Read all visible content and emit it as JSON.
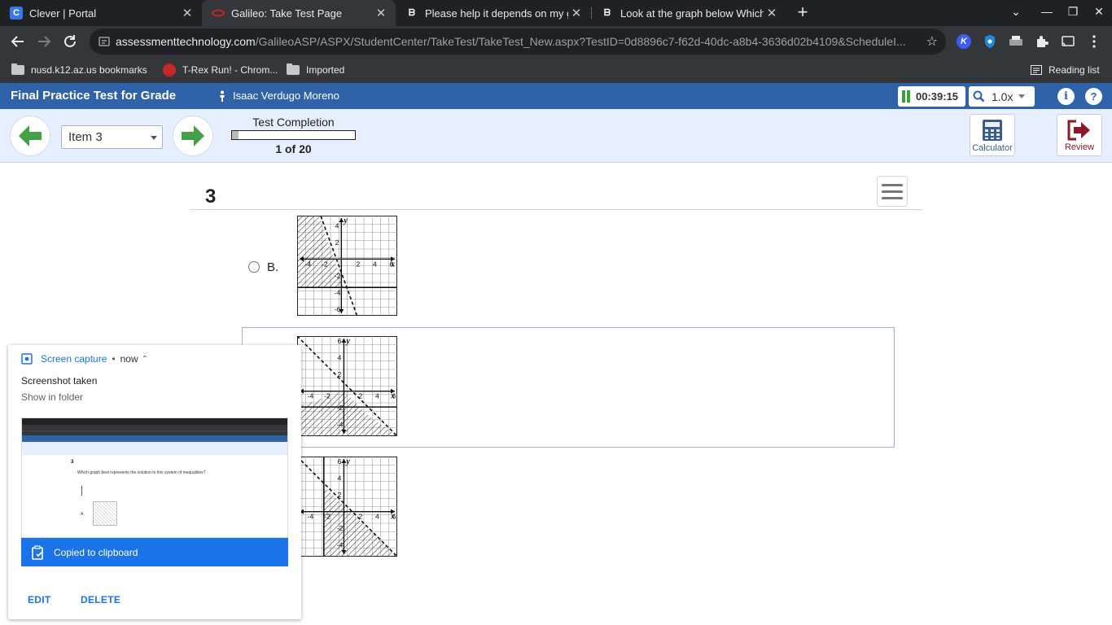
{
  "browser": {
    "tabs": [
      {
        "title": "Clever | Portal",
        "favicon": "clever-icon",
        "active": false
      },
      {
        "title": "Galileo: Take Test Page",
        "favicon": "galileo-icon",
        "active": true
      },
      {
        "title": "Please help it depends on my gr",
        "favicon": "brainly-icon",
        "active": false
      },
      {
        "title": "Look at the graph below Which p",
        "favicon": "brainly-icon",
        "active": false
      }
    ],
    "url_domain": "assessmenttechnology.com",
    "url_path": "/GalileoASP/ASPX/StudentCenter/TakeTest/TakeTest_New.aspx?TestID=0d8896c7-f62d-40dc-a8b4-3636d02b4109&ScheduleI...",
    "bookmarks": [
      {
        "label": "nusd.k12.az.us bookmarks",
        "icon": "folder-icon"
      },
      {
        "label": "T-Rex Run! - Chrom...",
        "icon": "trex-icon"
      },
      {
        "label": "Imported",
        "icon": "folder-icon"
      }
    ],
    "reading_list": "Reading list"
  },
  "app": {
    "test_title": "Final Practice Test for Grade",
    "student_name": "Isaac Verdugo Moreno",
    "timer": "00:39:15",
    "zoom": "1.0x",
    "accent": "#2f62a7"
  },
  "nav": {
    "item_select": "Item 3",
    "completion_label": "Test Completion",
    "completion_count": "1 of 20",
    "completion_fraction": 0.05,
    "calculator_label": "Calculator",
    "review_label": "Review"
  },
  "question": {
    "number": "3",
    "option_b_label": "B.",
    "graph_ticks": {
      "x_neg": [
        "-6",
        "-4",
        "-2"
      ],
      "x_pos": [
        "2",
        "4",
        "6"
      ],
      "y_pos": [
        "6",
        "4",
        "2"
      ],
      "y_neg": [
        "-2",
        "-4",
        "-6"
      ],
      "x_axis": "x",
      "y_axis": "y"
    }
  },
  "capture": {
    "source": "Screen capture",
    "time": "now",
    "title": "Screenshot taken",
    "subtitle": "Show in folder",
    "copied": "Copied to clipboard",
    "edit": "EDIT",
    "delete": "DELETE",
    "thumb_text": "Which graph best represents the solution to this system of inequalities?",
    "thumb_option": "A."
  }
}
